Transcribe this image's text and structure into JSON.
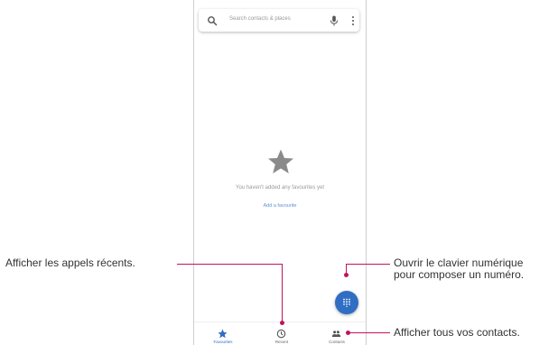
{
  "search": {
    "placeholder": "Search contacts & places"
  },
  "empty_state": {
    "message": "You haven't added any favourites yet",
    "add_link": "Add a favourite"
  },
  "nav": {
    "items": [
      {
        "label": "Favourites",
        "icon": "star-icon",
        "active": true
      },
      {
        "label": "Recent",
        "icon": "clock-icon",
        "active": false
      },
      {
        "label": "Contacts",
        "icon": "people-icon",
        "active": false
      }
    ]
  },
  "fab": {
    "icon": "dialpad-icon"
  },
  "callouts": {
    "recent": "Afficher les appels récents.",
    "dialpad_line1": "Ouvrir le clavier numérique",
    "dialpad_line2": "pour composer un numéro.",
    "contacts": "Afficher tous vos contacts."
  },
  "colors": {
    "accent": "#2f6ec3",
    "callout_line": "#c0145a",
    "star_gray": "#8a8a8a"
  }
}
